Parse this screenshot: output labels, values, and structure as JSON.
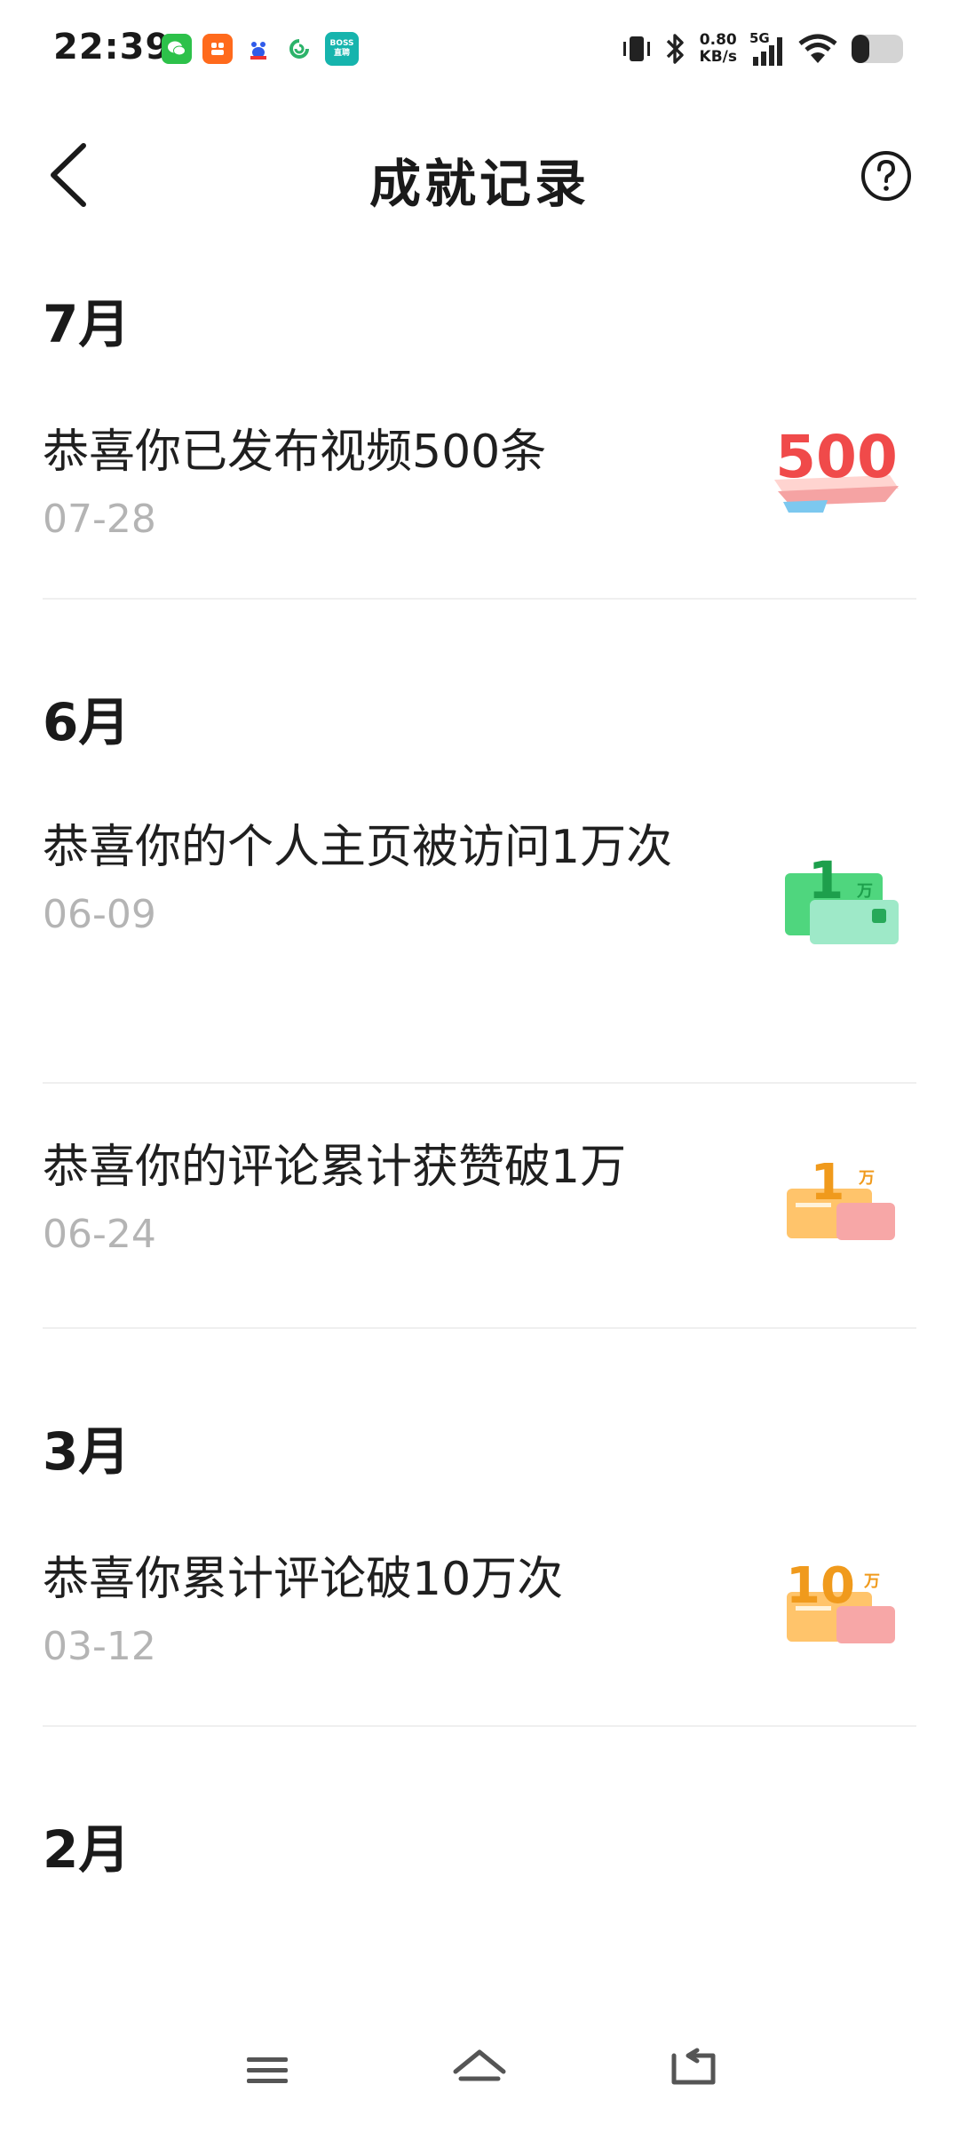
{
  "status_bar": {
    "time": "22:39",
    "speed_value": "0.80",
    "speed_unit": "KB/s",
    "network": "5G",
    "app_icons": [
      "wechat-icon",
      "taobao-icon",
      "baidu-icon",
      "app-icon",
      "boss-zhipin-icon"
    ],
    "boss_label": "BOSS\n直聘"
  },
  "header": {
    "title": "成就记录"
  },
  "sections": [
    {
      "month": "7月",
      "items": [
        {
          "text": "恭喜你已发布视频500条",
          "date": "07-28",
          "badge": "500",
          "badge_color": "#f04a4a"
        }
      ]
    },
    {
      "month": "6月",
      "items": [
        {
          "text": "恭喜你的个人主页被访问1万次",
          "date": "06-09",
          "badge": "1",
          "badge_unit": "万",
          "badge_color": "#2ec36b"
        },
        {
          "text": "恭喜你的评论累计获赞破1万",
          "date": "06-24",
          "badge": "1",
          "badge_unit": "万",
          "badge_color": "#f5a623"
        }
      ]
    },
    {
      "month": "3月",
      "items": [
        {
          "text": "恭喜你累计评论破10万次",
          "date": "03-12",
          "badge": "10",
          "badge_unit": "万",
          "badge_color": "#f5a623"
        }
      ]
    },
    {
      "month": "2月",
      "items": []
    }
  ],
  "nav": {
    "buttons": [
      "menu-icon",
      "home-icon",
      "back-icon"
    ]
  }
}
